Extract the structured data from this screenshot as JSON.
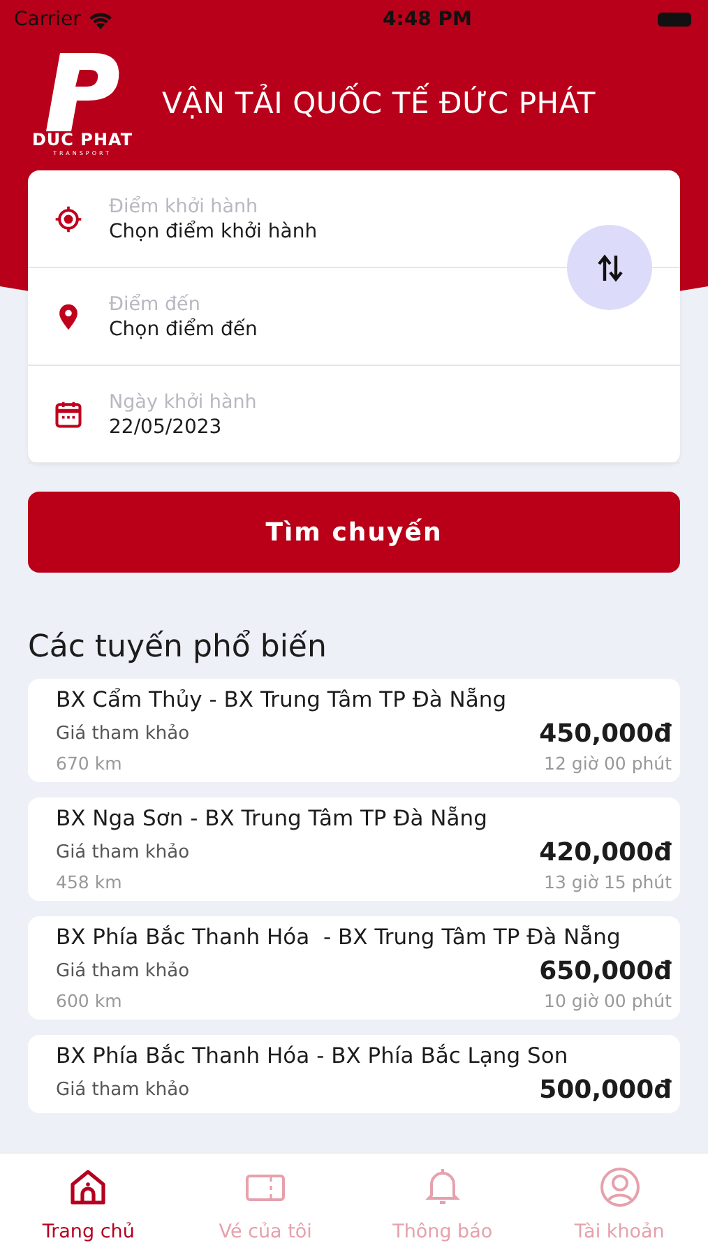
{
  "status_bar": {
    "carrier": "Carrier",
    "time": "4:48 PM"
  },
  "header": {
    "logo_name": "DUC PHAT",
    "logo_tagline": "TRANSPORT",
    "title": "VẬN TẢI QUỐC TẾ ĐỨC PHÁT"
  },
  "search_form": {
    "fields": [
      {
        "kind": "origin",
        "label": "Điểm khởi hành",
        "value": "Chọn điểm khởi hành"
      },
      {
        "kind": "destination",
        "label": "Điểm đến",
        "value": "Chọn điểm đến"
      },
      {
        "kind": "date",
        "label": "Ngày khởi hành",
        "value": "22/05/2023"
      }
    ],
    "search_button": "Tìm chuyến"
  },
  "popular_routes": {
    "heading": "Các tuyến phổ biến",
    "routes": [
      {
        "name": "BX Cẩm Thủy - BX Trung Tâm TP Đà Nẵng",
        "price_label": "Giá tham khảo",
        "price": "450,000đ",
        "distance": "670 km",
        "duration": "12 giờ 00 phút"
      },
      {
        "name": "BX Nga Sơn - BX Trung Tâm TP Đà Nẵng",
        "price_label": "Giá tham khảo",
        "price": "420,000đ",
        "distance": "458 km",
        "duration": "13 giờ 15 phút"
      },
      {
        "name": "BX Phía Bắc Thanh Hóa  - BX Trung Tâm TP Đà Nẵng",
        "price_label": "Giá tham khảo",
        "price": "650,000đ",
        "distance": "600 km",
        "duration": "10 giờ 00 phút"
      },
      {
        "name": "BX Phía Bắc Thanh Hóa - BX Phía Bắc Lạng Son",
        "price_label": "Giá tham khảo",
        "price": "500,000đ"
      }
    ]
  },
  "tab_bar": [
    {
      "kind": "home",
      "label": "Trang chủ",
      "selected": true
    },
    {
      "kind": "tickets",
      "label": "Vé của tôi",
      "selected": false
    },
    {
      "kind": "notifications",
      "label": "Thông báo",
      "selected": false
    },
    {
      "kind": "account",
      "label": "Tài khoản",
      "selected": false
    }
  ]
}
